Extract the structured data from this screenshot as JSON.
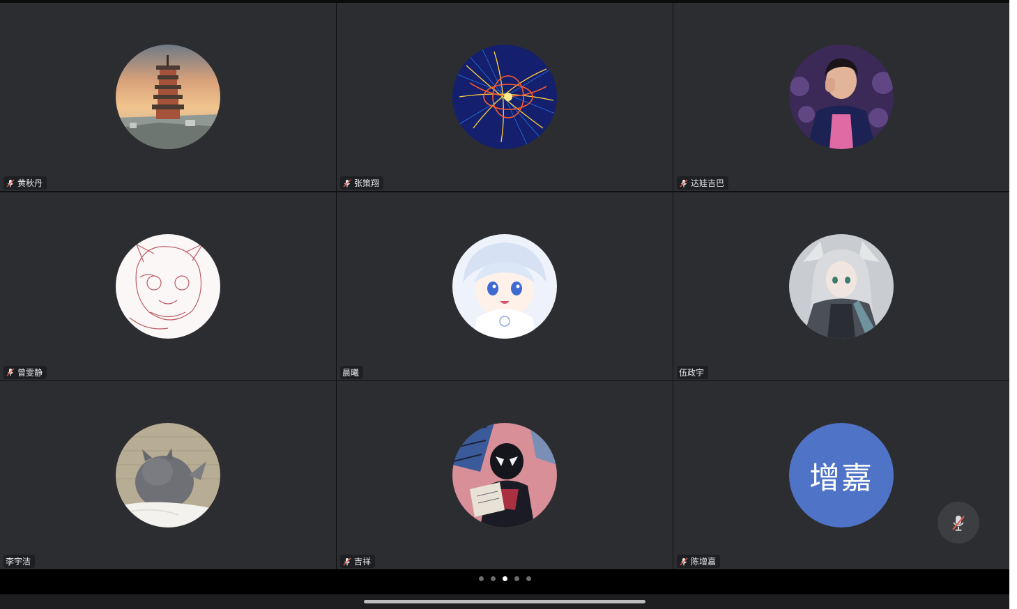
{
  "participants": [
    {
      "name": "黄秋丹",
      "muted": true,
      "avatar": "pagoda-sunset"
    },
    {
      "name": "张策翔",
      "muted": true,
      "avatar": "particle-collision"
    },
    {
      "name": "达娃吉巴",
      "muted": true,
      "avatar": "person-photo"
    },
    {
      "name": "曾雯静",
      "muted": true,
      "avatar": "sketch-drawing"
    },
    {
      "name": "晨曦",
      "muted": false,
      "avatar": "anime-girl"
    },
    {
      "name": "伍政宇",
      "muted": false,
      "avatar": "anime-character"
    },
    {
      "name": "李宇洁",
      "muted": false,
      "avatar": "cat-photo"
    },
    {
      "name": "吉祥",
      "muted": true,
      "avatar": "spider-hero-comic"
    },
    {
      "name": "陈增嘉",
      "muted": true,
      "avatar": "text-initials",
      "initials": "增嘉"
    }
  ],
  "pager": {
    "total": 5,
    "current": 3
  },
  "float_button": {
    "icon": "mic-muted-icon"
  },
  "colors": {
    "tile_bg": "#2c2d31",
    "initials_avatar": "#4f74c7",
    "muted_icon": "#e05a4a"
  }
}
